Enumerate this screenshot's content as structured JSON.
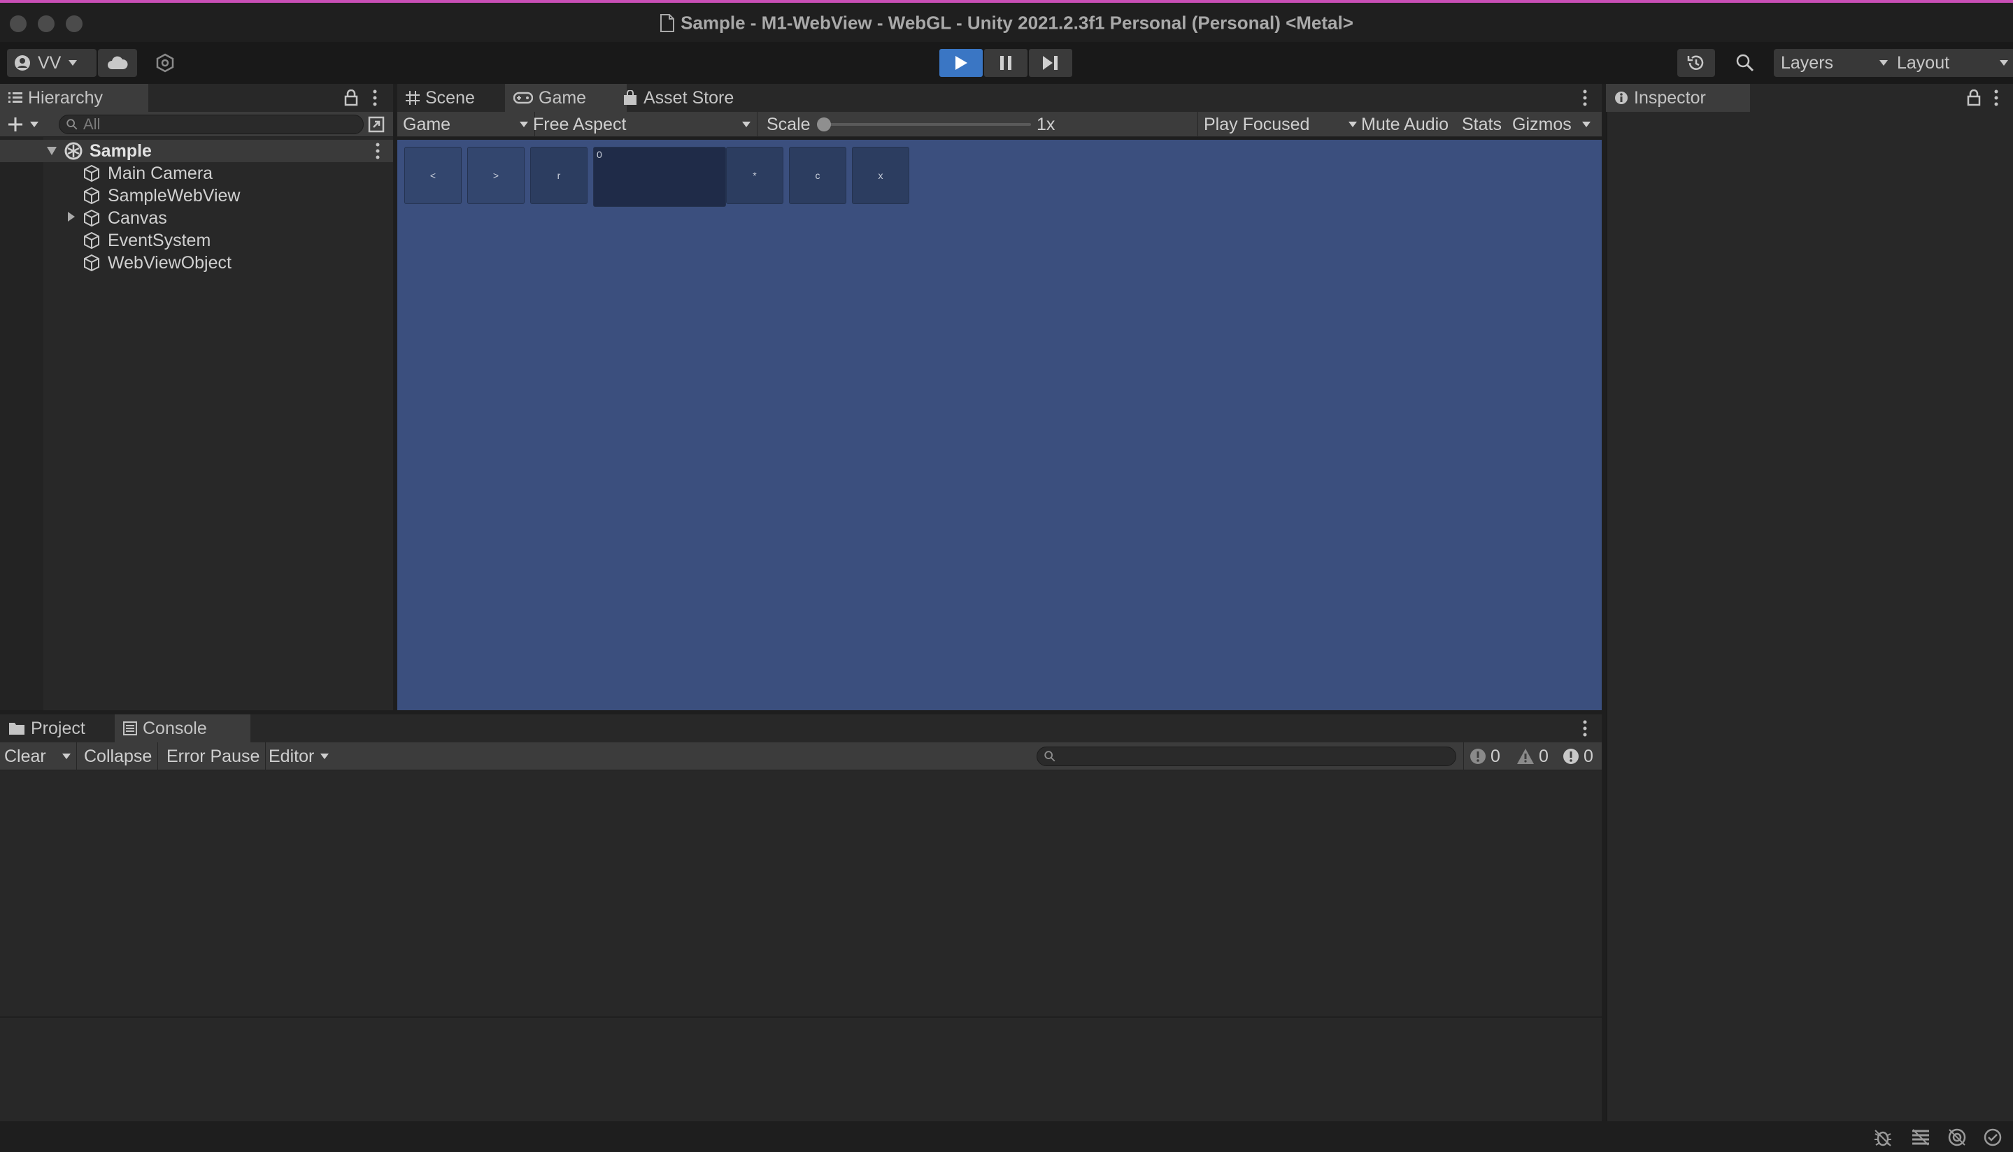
{
  "window": {
    "title": "Sample - M1-WebView - WebGL - Unity 2021.2.3f1 Personal (Personal) <Metal>"
  },
  "toolbar": {
    "account_label": "VV",
    "layers_label": "Layers",
    "layout_label": "Layout"
  },
  "hierarchy": {
    "tab_label": "Hierarchy",
    "search_placeholder": "All",
    "scene_name": "Sample",
    "items": [
      {
        "label": "Main Camera"
      },
      {
        "label": "SampleWebView"
      },
      {
        "label": "Canvas",
        "expandable": true
      },
      {
        "label": "EventSystem"
      },
      {
        "label": "WebViewObject"
      }
    ]
  },
  "center_tabs": [
    {
      "label": "Scene",
      "icon": "grid-icon"
    },
    {
      "label": "Game",
      "icon": "gamepad-icon"
    },
    {
      "label": "Asset Store",
      "icon": "bag-icon"
    }
  ],
  "game_toolbar": {
    "display": "Game",
    "aspect": "Free Aspect",
    "scale_label": "Scale",
    "scale_value": "1x",
    "play_mode": "Play Focused",
    "mute": "Mute Audio",
    "stats": "Stats",
    "gizmos": "Gizmos"
  },
  "game_buttons": [
    {
      "label": "<"
    },
    {
      "label": ">"
    },
    {
      "label": "r"
    },
    {
      "label": "0"
    },
    {
      "label": "*"
    },
    {
      "label": "c"
    },
    {
      "label": "x"
    }
  ],
  "inspector": {
    "tab_label": "Inspector"
  },
  "bottom_tabs": [
    {
      "label": "Project",
      "icon": "folder-icon"
    },
    {
      "label": "Console",
      "icon": "console-icon"
    }
  ],
  "console": {
    "clear": "Clear",
    "collapse": "Collapse",
    "error_pause": "Error Pause",
    "editor": "Editor",
    "info_count": "0",
    "warning_count": "0",
    "error_count": "0"
  },
  "colors": {
    "game_background": "#3b4f7e",
    "play_active": "#3a76c4",
    "title_accent": "#c94fb6"
  }
}
